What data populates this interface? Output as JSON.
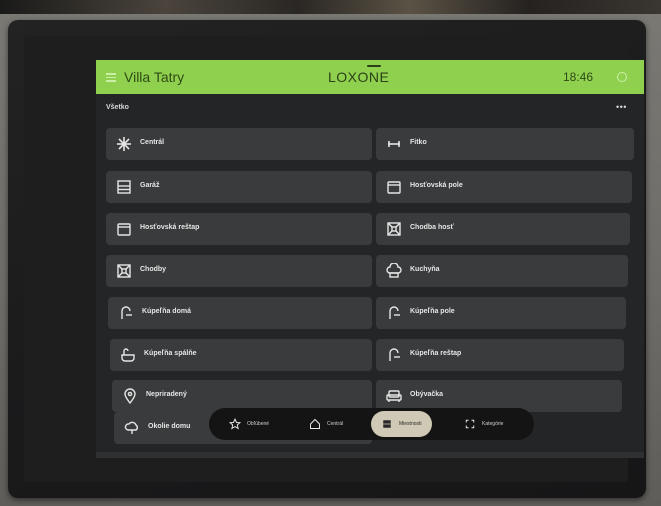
{
  "header": {
    "site_name": "Villa Tatry",
    "logo": "LOXONE",
    "time": "18:46"
  },
  "section": {
    "title": "Všetko"
  },
  "tiles": [
    {
      "label": "Centrál",
      "icon": "central-icon"
    },
    {
      "label": "Fitko",
      "icon": "dumbbell-icon"
    },
    {
      "label": "Garáž",
      "icon": "garage-icon"
    },
    {
      "label": "Hosťovská pole",
      "icon": "bed-icon"
    },
    {
      "label": "Hosťovská reštap",
      "icon": "bed-icon"
    },
    {
      "label": "Chodba hosť",
      "icon": "hallway-icon"
    },
    {
      "label": "Chodby",
      "icon": "hallway-icon"
    },
    {
      "label": "Kuchyňa",
      "icon": "chef-hat-icon"
    },
    {
      "label": "Kúpeľňa domá",
      "icon": "shower-icon"
    },
    {
      "label": "Kúpeľňa pole",
      "icon": "shower-icon"
    },
    {
      "label": "Kúpeľňa spálňe",
      "icon": "bathtub-icon"
    },
    {
      "label": "Kúpeľňa reštap",
      "icon": "shower-icon"
    },
    {
      "label": "Nepriradený",
      "icon": "location-pin-icon"
    },
    {
      "label": "Obývačka",
      "icon": "sofa-icon"
    },
    {
      "label": "Okolie domu",
      "icon": "cloud-icon"
    }
  ],
  "nav": [
    {
      "label": "Obľúbené",
      "icon": "star-icon"
    },
    {
      "label": "Centrál",
      "icon": "home-icon"
    },
    {
      "label": "Miestnosti",
      "icon": "rooms-icon",
      "active": true
    },
    {
      "label": "Kategórie",
      "icon": "categories-icon"
    }
  ],
  "colors": {
    "header_bg": "#8fd14f",
    "tile_bg": "#3a3b3c",
    "screen_bg": "#242526",
    "active_nav": "#cfc9b6"
  }
}
